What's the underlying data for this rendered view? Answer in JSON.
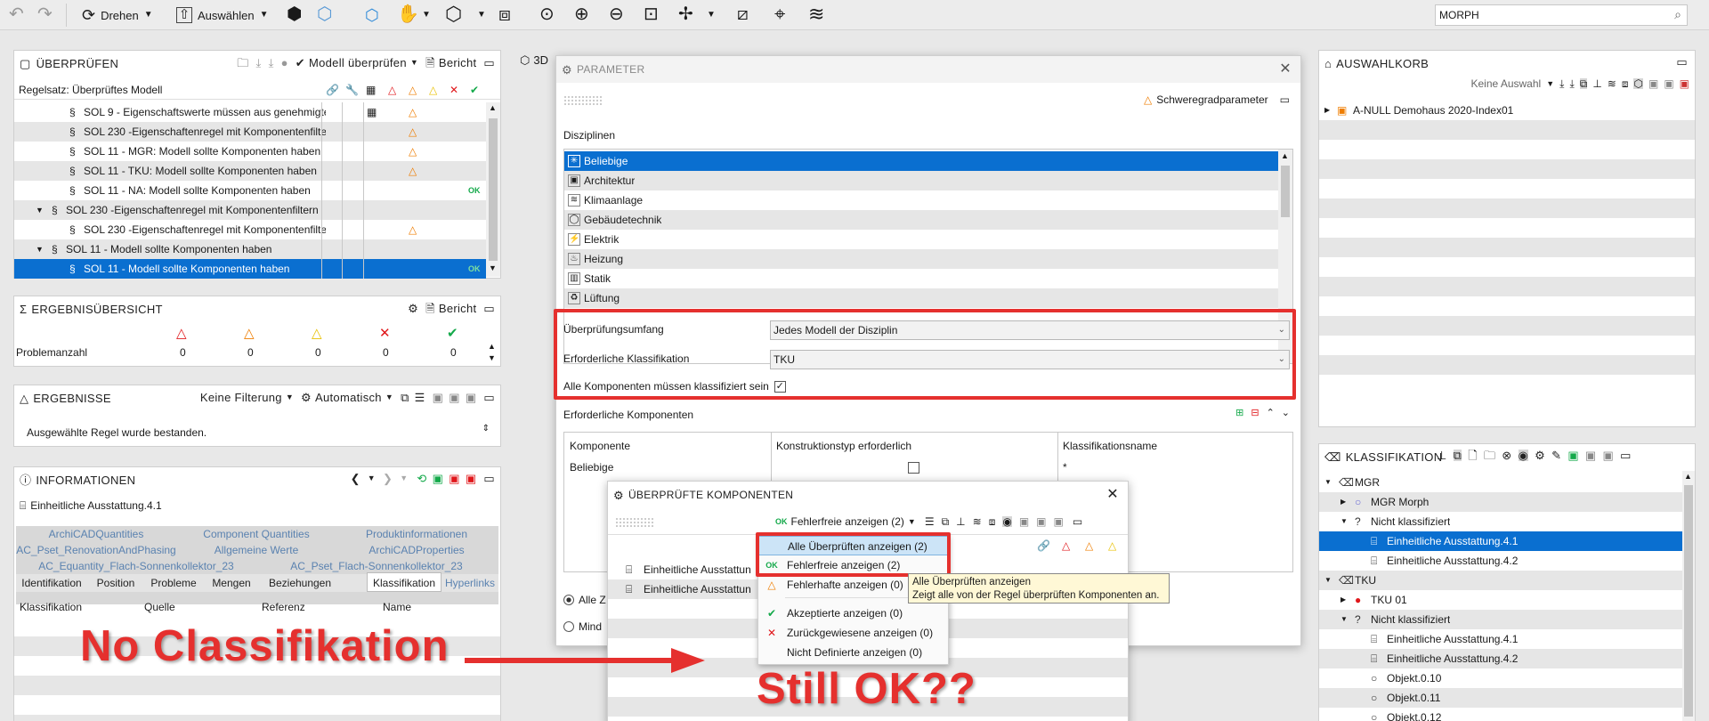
{
  "toolbar": {
    "rotate": "Drehen",
    "select": "Auswählen",
    "search_value": "MORPH"
  },
  "check_panel": {
    "title": "ÜBERPRÜFEN",
    "check_model": "Modell überprüfen",
    "report": "Bericht",
    "ruleset": "Regelsatz: Überprüftes Modell",
    "rows": [
      "SOL 9 - Eigenschaftswerte müssen aus genehmigte",
      "SOL 230 -Eigenschaftenregel mit Komponentenfilte",
      "SOL 11 - MGR: Modell sollte Komponenten haben",
      "SOL 11 - TKU: Modell sollte Komponenten haben",
      "SOL 11 - NA: Modell sollte Komponenten haben",
      "SOL 230 -Eigenschaftenregel mit Komponentenfiltern",
      "SOL 230 -Eigenschaftenregel mit Komponentenfilte",
      "SOL 11 - Modell sollte Komponenten haben",
      "SOL 11 - Modell sollte Komponenten haben"
    ],
    "ok": "OK"
  },
  "summary_panel": {
    "title": "ERGEBNISÜBERSICHT",
    "report": "Bericht",
    "row_label": "Problemanzahl",
    "counts": [
      "0",
      "0",
      "0",
      "0",
      "0"
    ]
  },
  "results_panel": {
    "title": "ERGEBNISSE",
    "filter": "Keine Filterung",
    "auto": "Automatisch",
    "message": "Ausgewählte Regel wurde bestanden."
  },
  "info_panel": {
    "title": "INFORMATIONEN",
    "item": "Einheitliche Ausstattung.4.1",
    "tabs_row1": [
      "ArchiCADQuantities",
      "Component Quantities",
      "Produktinformationen"
    ],
    "tabs_row2": [
      "AC_Pset_RenovationAndPhasing",
      "Allgemeine Werte",
      "ArchiCADProperties"
    ],
    "tabs_row3": [
      "AC_Equantity_Flach-Sonnenkollektor_23",
      "AC_Pset_Flach-Sonnenkollektor_23"
    ],
    "tabs_row4": [
      "Identifikation",
      "Position",
      "Probleme",
      "Mengen",
      "Beziehungen",
      "Klassifikation",
      "Hyperlinks"
    ],
    "columns": [
      "Klassifikation",
      "Quelle",
      "Referenz",
      "Name"
    ]
  },
  "view3d_tab": "3D",
  "param_dialog": {
    "title": "PARAMETER",
    "severity": "Schweregradparameter",
    "disciplines_label": "Disziplinen",
    "disciplines": [
      "Beliebige",
      "Architektur",
      "Klimaanlage",
      "Gebäudetechnik",
      "Elektrik",
      "Heizung",
      "Statik",
      "Lüftung"
    ],
    "scope_label": "Überprüfungsumfang",
    "scope_value": "Jedes Modell der Disziplin",
    "class_label": "Erforderliche Klassifikation",
    "class_value": "TKU",
    "all_classified_label": "Alle Komponenten müssen klassifiziert sein",
    "components_label": "Erforderliche Komponenten",
    "comp_columns": [
      "Komponente",
      "Konstruktionstyp erforderlich",
      "Klassifikationsname"
    ],
    "comp_row": {
      "name": "Beliebige",
      "class": "*"
    },
    "radio1": "Alle Z",
    "radio2": "Mind"
  },
  "checked_dialog": {
    "title": "ÜBERPRÜFTE KOMPONENTEN",
    "filter": "Fehlerfreie anzeigen (2)",
    "ok": "OK",
    "items": [
      "Einheitliche Ausstattun",
      "Einheitliche Ausstattun"
    ]
  },
  "menu": {
    "items": [
      "Alle Überprüften anzeigen (2)",
      "Fehlerfreie anzeigen (2)",
      "Fehlerhafte anzeigen (0)",
      "Akzeptierte anzeigen (0)",
      "Zurückgewiesene anzeigen (0)",
      "Nicht Definierte anzeigen (0)"
    ]
  },
  "tooltip": {
    "line1": "Alle Überprüften anzeigen",
    "line2": "Zeigt alle von der Regel überprüften Komponenten an."
  },
  "basket_panel": {
    "title": "AUSWAHLKORB",
    "selection": "Keine Auswahl",
    "model": "A-NULL Demohaus 2020-Index01"
  },
  "class_panel": {
    "title": "KLASSIFIKATION",
    "tree": [
      "MGR",
      "MGR Morph",
      "Nicht klassifiziert",
      "Einheitliche Ausstattung.4.1",
      "Einheitliche Ausstattung.4.2",
      "TKU",
      "TKU 01",
      "Nicht klassifiziert",
      "Einheitliche Ausstattung.4.1",
      "Einheitliche Ausstattung.4.2",
      "Objekt.0.10",
      "Objekt.0.11",
      "Objekt.0.12"
    ]
  },
  "annotations": {
    "left": "No Classifikation",
    "right": "Still OK??"
  },
  "colors": {
    "accent": "#0a6fd0",
    "annotation": "#e5302e",
    "error": "#e0171b",
    "warning": "#ef7d00",
    "ok": "#14a94a"
  }
}
